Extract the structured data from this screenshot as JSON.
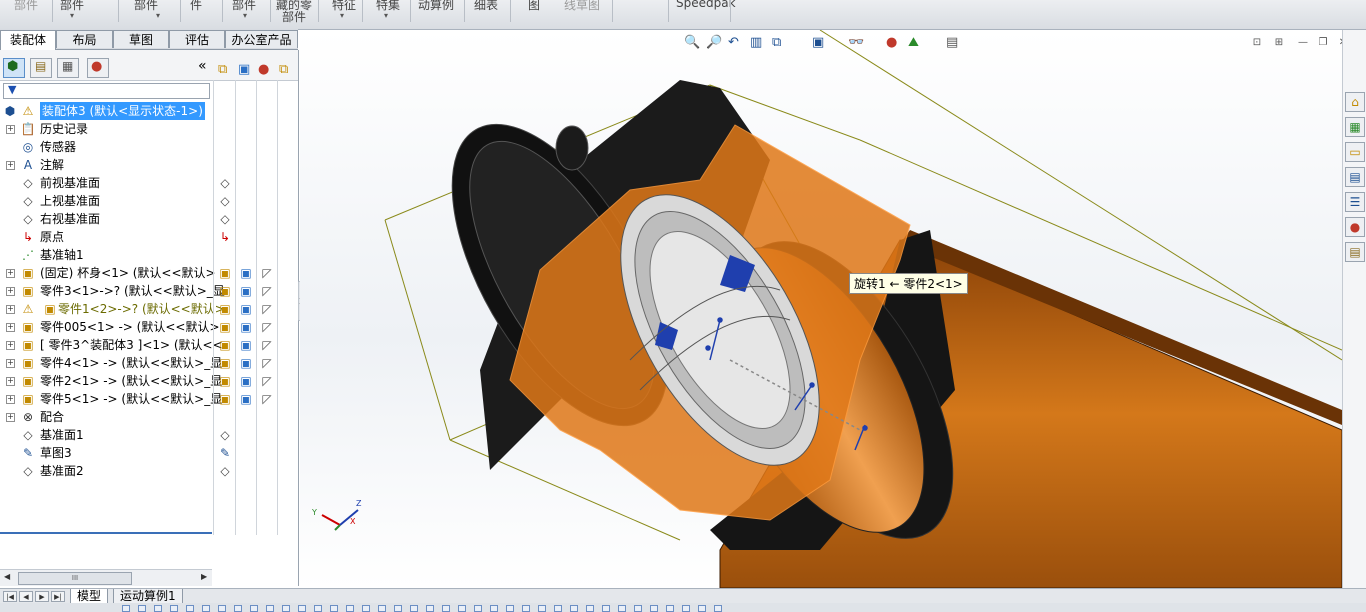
{
  "ribbon": {
    "items": [
      {
        "label": "部件",
        "gray": true
      },
      {
        "label": "部件",
        "gray": false
      },
      {
        "label": "部件",
        "gray": false
      },
      {
        "label": "件",
        "gray": false
      },
      {
        "label": "部件",
        "gray": false
      },
      {
        "label": "藏的零",
        "gray": false
      },
      {
        "label": "部件",
        "gray": false
      },
      {
        "label": "特征",
        "gray": false
      },
      {
        "label": "特集",
        "gray": false
      },
      {
        "label": "动算例",
        "gray": false
      },
      {
        "label": "细表",
        "gray": false
      },
      {
        "label": "图",
        "gray": false
      },
      {
        "label": "线草图",
        "gray": true
      },
      {
        "label": "Speedpak",
        "gray": false
      }
    ]
  },
  "tabs": [
    "装配体",
    "布局",
    "草图",
    "评估",
    "办公室产品"
  ],
  "active_tab": "装配体",
  "collapse_glyph": "«",
  "tree": [
    {
      "label": "装配体3  (默认<显示状态-1>)",
      "icon": "assembly-icon",
      "glyph": "⚠",
      "exp": "",
      "highlight": true,
      "warn": false
    },
    {
      "label": "历史记录",
      "icon": "history-icon",
      "glyph": "📋",
      "exp": "+",
      "highlight": false,
      "warn": false
    },
    {
      "label": "传感器",
      "icon": "sensor-icon",
      "glyph": "◎",
      "exp": "",
      "highlight": false,
      "warn": false
    },
    {
      "label": "注解",
      "icon": "annotation-icon",
      "glyph": "A",
      "exp": "+",
      "highlight": false,
      "warn": false
    },
    {
      "label": "前视基准面",
      "icon": "plane-icon",
      "glyph": "◇",
      "exp": "",
      "highlight": false,
      "warn": false
    },
    {
      "label": "上视基准面",
      "icon": "plane-icon",
      "glyph": "◇",
      "exp": "",
      "highlight": false,
      "warn": false
    },
    {
      "label": "右视基准面",
      "icon": "plane-icon",
      "glyph": "◇",
      "exp": "",
      "highlight": false,
      "warn": false
    },
    {
      "label": "原点",
      "icon": "origin-icon",
      "glyph": "↳",
      "exp": "",
      "highlight": false,
      "warn": false
    },
    {
      "label": "基准轴1",
      "icon": "axis-icon",
      "glyph": "⋰",
      "exp": "",
      "highlight": false,
      "warn": false
    },
    {
      "label": "(固定) 杯身<1> (默认<<默认>",
      "icon": "part-icon",
      "glyph": "▣",
      "exp": "+",
      "highlight": false,
      "warn": false
    },
    {
      "label": "零件3<1>->? (默认<<默认>_显",
      "icon": "part-icon",
      "glyph": "▣",
      "exp": "+",
      "highlight": false,
      "warn": false
    },
    {
      "label": "零件1<2>->? (默认<<默认>",
      "icon": "part-warning-icon",
      "glyph": "⚠",
      "exp": "+",
      "highlight": false,
      "warn": true
    },
    {
      "label": "零件005<1> -> (默认<<默认>",
      "icon": "part-icon",
      "glyph": "▣",
      "exp": "+",
      "highlight": false,
      "warn": false
    },
    {
      "label": "[ 零件3^装配体3 ]<1> (默认<<",
      "icon": "part-icon",
      "glyph": "▣",
      "exp": "+",
      "highlight": false,
      "warn": false
    },
    {
      "label": "零件4<1> -> (默认<<默认>_显",
      "icon": "part-icon",
      "glyph": "▣",
      "exp": "+",
      "highlight": false,
      "warn": false
    },
    {
      "label": "零件2<1> -> (默认<<默认>_显",
      "icon": "part-icon",
      "glyph": "▣",
      "exp": "+",
      "highlight": false,
      "warn": false
    },
    {
      "label": "零件5<1> -> (默认<<默认>_显",
      "icon": "part-icon",
      "glyph": "▣",
      "exp": "+",
      "highlight": false,
      "warn": false
    },
    {
      "label": "配合",
      "icon": "mates-icon",
      "glyph": "⊗",
      "exp": "+",
      "highlight": false,
      "warn": false
    },
    {
      "label": "基准面1",
      "icon": "plane-icon",
      "glyph": "◇",
      "exp": "",
      "highlight": false,
      "warn": false
    },
    {
      "label": "草图3",
      "icon": "sketch-icon",
      "glyph": "✎",
      "exp": "",
      "highlight": false,
      "warn": false
    },
    {
      "label": "基准面2",
      "icon": "plane-icon",
      "glyph": "◇",
      "exp": "",
      "highlight": false,
      "warn": false
    }
  ],
  "tooltip": "旋转1 ← 零件2<1>",
  "bottom_tabs": [
    "模型",
    "运动算例1"
  ],
  "active_bottom_tab": "模型",
  "hscroll_label": "III",
  "colors": {
    "selection": "#3399ff",
    "body_orange": "#c8660f",
    "cap_black": "#141414",
    "inner_orange": "#e07818",
    "mate_blue": "#1f3fae"
  }
}
